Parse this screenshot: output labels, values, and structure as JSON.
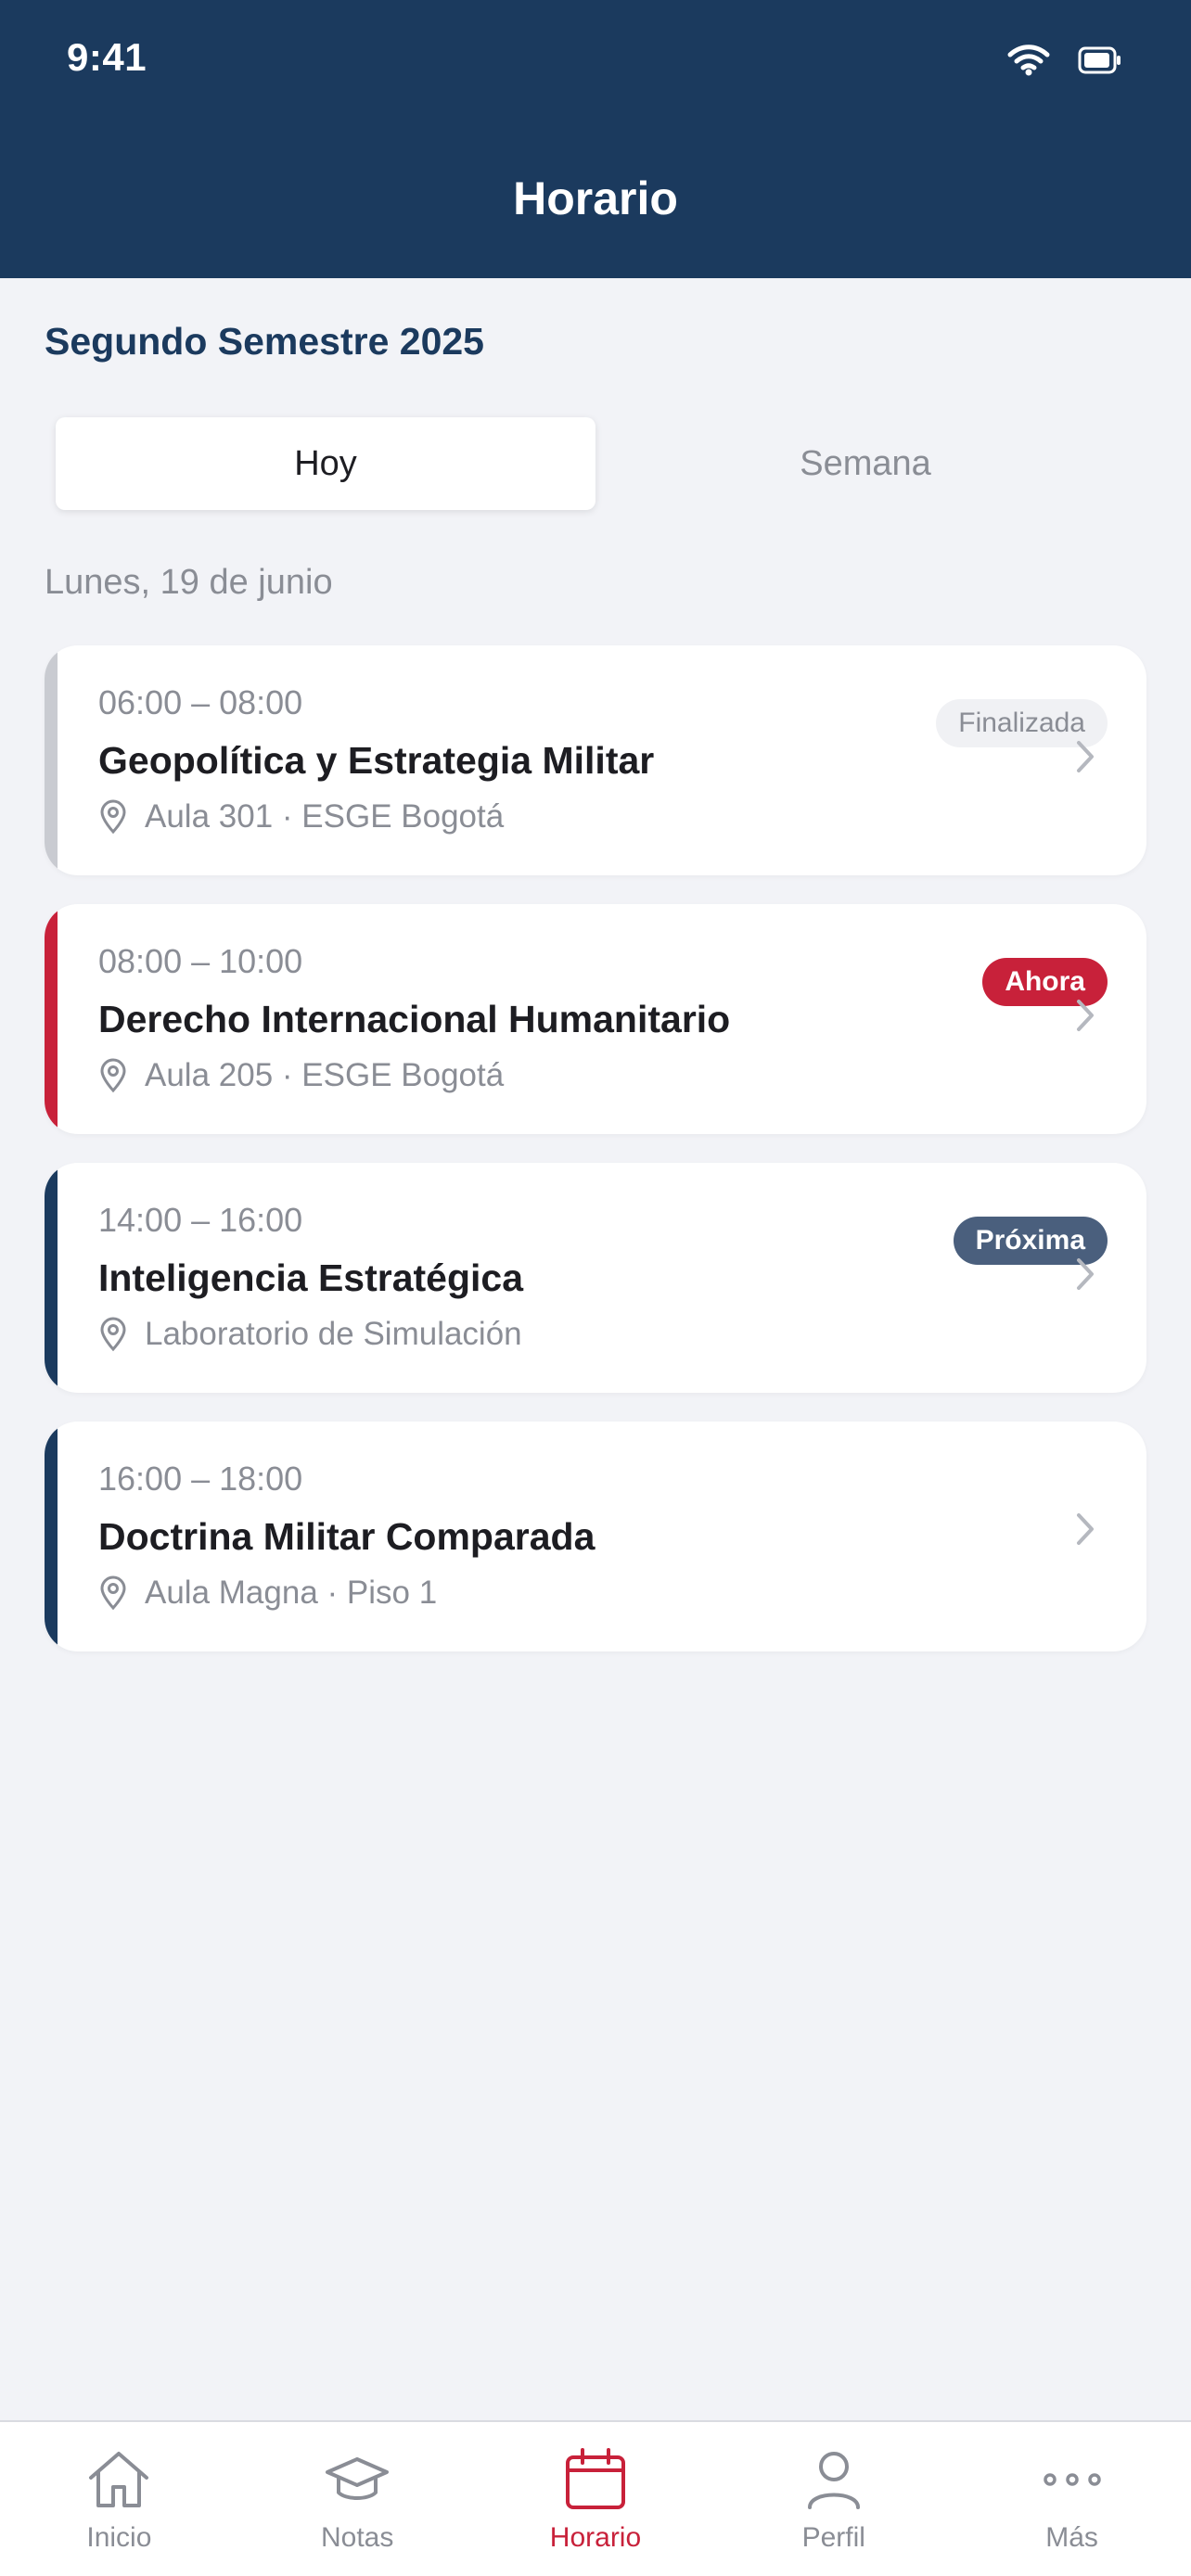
{
  "status_bar": {
    "time": "9:41"
  },
  "header": {
    "title": "Horario"
  },
  "semester": "Segundo Semestre 2025",
  "segments": {
    "today": "Hoy",
    "week": "Semana"
  },
  "date_label": "Lunes, 19 de junio",
  "classes": [
    {
      "time": "06:00 – 08:00",
      "title": "Geopolítica y Estrategia Militar",
      "location": "Aula 301 · ESGE Bogotá",
      "badge": "Finalizada",
      "accent": "#c9cbd1"
    },
    {
      "time": "08:00 – 10:00",
      "title": "Derecho Internacional Humanitario",
      "location": "Aula 205 · ESGE Bogotá",
      "badge": "Ahora",
      "accent": "#c8213a"
    },
    {
      "time": "14:00 – 16:00",
      "title": "Inteligencia Estratégica",
      "location": "Laboratorio de Simulación",
      "badge": "Próxima",
      "accent": "#1b3a5e"
    },
    {
      "time": "16:00 – 18:00",
      "title": "Doctrina Militar Comparada",
      "location": "Aula Magna · Piso 1",
      "badge": "",
      "accent": "#1b3a5e"
    }
  ],
  "tabbar": {
    "items": [
      {
        "label": "Inicio",
        "icon": "home-icon"
      },
      {
        "label": "Notas",
        "icon": "graduation-cap-icon"
      },
      {
        "label": "Horario",
        "icon": "calendar-icon",
        "active": true
      },
      {
        "label": "Perfil",
        "icon": "user-icon"
      },
      {
        "label": "Más",
        "icon": "more-icon"
      }
    ]
  },
  "colors": {
    "primary": "#1b3a5e",
    "accent": "#c8213a",
    "background": "#f2f3f7"
  }
}
